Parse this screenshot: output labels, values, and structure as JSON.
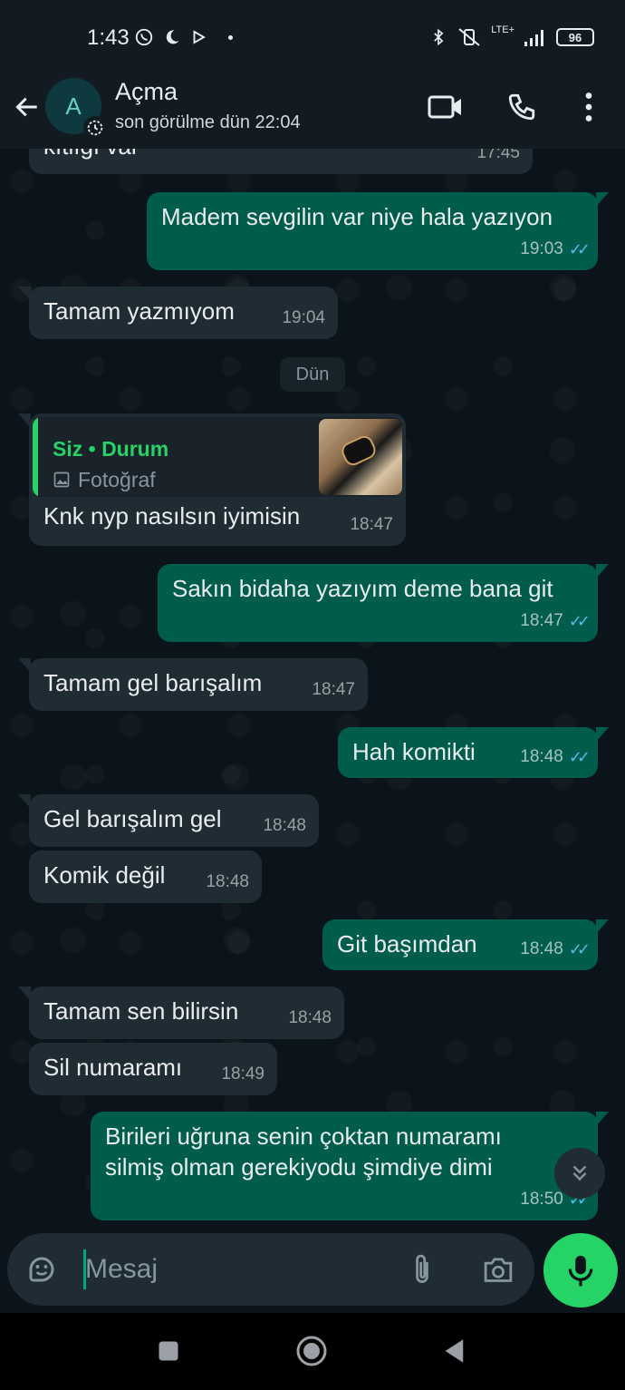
{
  "status_bar": {
    "time": "1:43",
    "network_label": "LTE+",
    "battery": "96"
  },
  "header": {
    "avatar_letter": "A",
    "contact_name": "Açma",
    "last_seen": "son görülme dün 22:04"
  },
  "messages": [
    {
      "text": "kıtlığı var",
      "time": "17:45"
    },
    {
      "text": "Madem sevgilin var niye hala yazıyon",
      "time": "19:03"
    },
    {
      "text": "Tamam yazmıyom",
      "time": "19:04"
    },
    {
      "date": "Dün"
    },
    {
      "quote_title": "Siz • Durum",
      "quote_sub": "Fotoğraf",
      "text": "Knk nyp nasılsın iyimisin",
      "time": "18:47"
    },
    {
      "text": "Sakın bidaha yazıyım deme bana git",
      "time": "18:47"
    },
    {
      "text": "Tamam gel barışalım",
      "time": "18:47"
    },
    {
      "text": "Hah komikti",
      "time": "18:48"
    },
    {
      "text": "Gel barışalım gel",
      "time": "18:48"
    },
    {
      "text": "Komik değil",
      "time": "18:48"
    },
    {
      "text": "Git başımdan",
      "time": "18:48"
    },
    {
      "text": "Tamam sen bilirsin",
      "time": "18:48"
    },
    {
      "text": "Sil numaramı",
      "time": "18:49"
    },
    {
      "text_line1": "Birileri uğruna senin çoktan numaramı",
      "text_line2": "silmiş olman gerekiyodu şimdiye dimi",
      "time": "18:50"
    }
  ],
  "composer": {
    "placeholder": "Mesaj"
  },
  "icons": {
    "back": "arrow-left-icon",
    "video": "video-call-icon",
    "phone": "phone-icon",
    "menu": "more-vert-icon",
    "emoji": "sticker-icon",
    "attach": "paperclip-icon",
    "camera": "camera-icon",
    "mic": "mic-icon",
    "scroll": "double-chevron-down-icon"
  },
  "colors": {
    "accent": "#25d366",
    "outgoing_bubble": "#005c4b",
    "incoming_bubble": "#202c33",
    "read_ticks": "#53bdeb"
  }
}
